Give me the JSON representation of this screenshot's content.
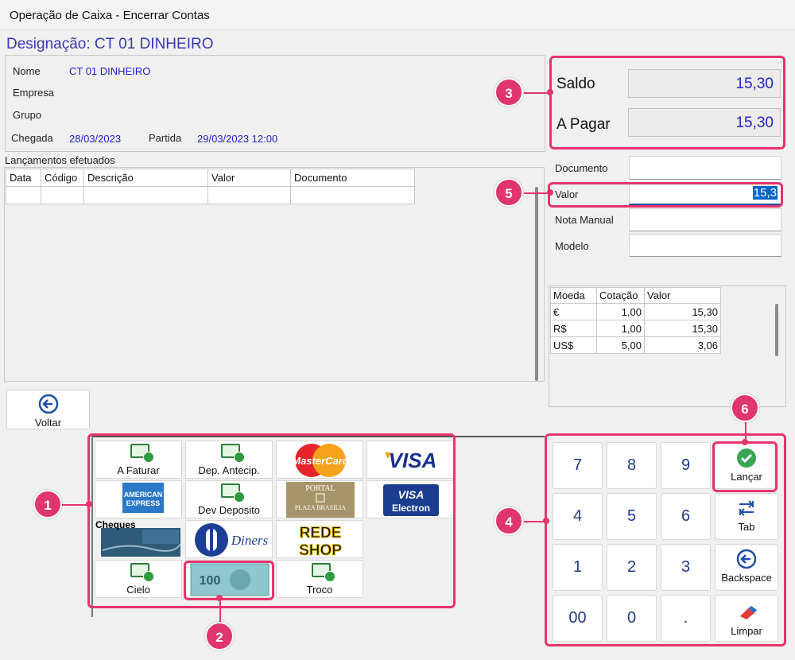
{
  "window": {
    "title": "Operação de Caixa - Encerrar Contas"
  },
  "designation": "Designação: CT 01 DINHEIRO",
  "info": {
    "nome_label": "Nome",
    "nome_value": "CT 01 DINHEIRO",
    "empresa_label": "Empresa",
    "grupo_label": "Grupo",
    "chegada_label": "Chegada",
    "chegada_value": "28/03/2023",
    "partida_label": "Partida",
    "partida_value": "29/03/2023 12:00"
  },
  "entries": {
    "title": "Lançamentos efetuados",
    "columns": [
      "Data",
      "Código",
      "Descrição",
      "Valor",
      "Documento"
    ]
  },
  "voltar_label": "Voltar",
  "payments": {
    "a_faturar": "A Faturar",
    "dep_antecip": "Dep. Antecip.",
    "dev_deposito": "Dev Deposito",
    "cielo": "Cielo",
    "troco": "Troco",
    "cheques": "Cheques",
    "logo_mastercard": "MasterCard",
    "logo_visa": "VISA",
    "logo_amex_1": "AMERICAN",
    "logo_amex_2": "EXPRESS",
    "logo_portal_1": "PORTAL",
    "logo_portal_2": "PLAZA BRASILIA",
    "logo_visa_electron_1": "VISA",
    "logo_visa_electron_2": "Electron",
    "logo_diners": "Diners",
    "logo_rede_1": "REDE",
    "logo_rede_2": "SHOP",
    "banknote_value": "100"
  },
  "summary": {
    "saldo_label": "Saldo",
    "saldo_value": "15,30",
    "apagar_label": "A Pagar",
    "apagar_value": "15,30"
  },
  "form": {
    "documento_label": "Documento",
    "valor_label": "Valor",
    "valor_value": "15,3",
    "nota_label": "Nota Manual",
    "modelo_label": "Modelo"
  },
  "currency": {
    "columns": [
      "Moeda",
      "Cotação",
      "Valor"
    ],
    "rows": [
      [
        "€",
        "1,00",
        "15,30"
      ],
      [
        "R$",
        "1,00",
        "15,30"
      ],
      [
        "US$",
        "5,00",
        "3,06"
      ]
    ]
  },
  "keypad": {
    "k7": "7",
    "k8": "8",
    "k9": "9",
    "k4": "4",
    "k5": "5",
    "k6": "6",
    "k1": "1",
    "k2": "2",
    "k3": "3",
    "k00": "00",
    "k0": "0",
    "kdot": ".",
    "lancar": "Lançar",
    "tab": "Tab",
    "backspace": "Backspace",
    "limpar": "Limpar"
  },
  "callouts": {
    "c1": "1",
    "c2": "2",
    "c3": "3",
    "c4": "4",
    "c5": "5",
    "c6": "6"
  },
  "colors": {
    "accent": "#e6356b",
    "value_blue": "#2222cc",
    "title_blue": "#3a3ab8"
  }
}
